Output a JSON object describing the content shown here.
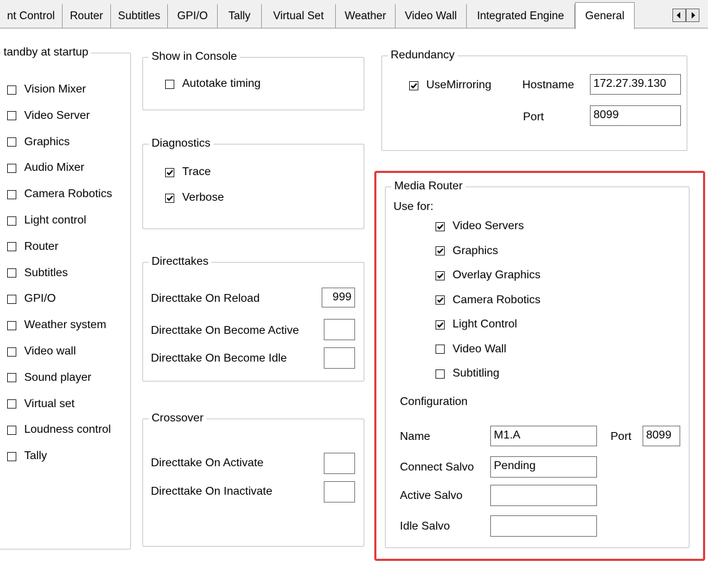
{
  "tabs": [
    {
      "label": "nt Control",
      "active": false
    },
    {
      "label": "Router",
      "active": false
    },
    {
      "label": "Subtitles",
      "active": false
    },
    {
      "label": "GPI/O",
      "active": false
    },
    {
      "label": "Tally",
      "active": false
    },
    {
      "label": "Virtual Set",
      "active": false
    },
    {
      "label": "Weather",
      "active": false
    },
    {
      "label": "Video Wall",
      "active": false
    },
    {
      "label": "Integrated Engine",
      "active": false
    },
    {
      "label": "General",
      "active": true
    }
  ],
  "scroll_buttons": {
    "left_icon": "arrow-left-icon",
    "right_icon": "arrow-right-icon"
  },
  "standby": {
    "title": "tandby at startup",
    "items": [
      {
        "label": "Vision Mixer",
        "checked": false
      },
      {
        "label": "Video Server",
        "checked": false
      },
      {
        "label": "Graphics",
        "checked": false
      },
      {
        "label": "Audio Mixer",
        "checked": false
      },
      {
        "label": "Camera Robotics",
        "checked": false
      },
      {
        "label": "Light control",
        "checked": false
      },
      {
        "label": "Router",
        "checked": false
      },
      {
        "label": "Subtitles",
        "checked": false
      },
      {
        "label": "GPI/O",
        "checked": false
      },
      {
        "label": "Weather system",
        "checked": false
      },
      {
        "label": "Video wall",
        "checked": false
      },
      {
        "label": "Sound player",
        "checked": false
      },
      {
        "label": "Virtual set",
        "checked": false
      },
      {
        "label": "Loudness control",
        "checked": false
      },
      {
        "label": "Tally",
        "checked": false
      }
    ]
  },
  "show_in_console": {
    "title": "Show in Console",
    "autotake": {
      "label": "Autotake timing",
      "checked": false
    }
  },
  "diagnostics": {
    "title": "Diagnostics",
    "trace": {
      "label": "Trace",
      "checked": true
    },
    "verbose": {
      "label": "Verbose",
      "checked": true
    }
  },
  "directtakes": {
    "title": "Directtakes",
    "on_reload": {
      "label": "Directtake On Reload",
      "value": "999"
    },
    "on_become_active": {
      "label": "Directtake On Become Active",
      "value": ""
    },
    "on_become_idle": {
      "label": "Directtake On Become Idle",
      "value": ""
    }
  },
  "crossover": {
    "title": "Crossover",
    "on_activate": {
      "label": "Directtake On Activate",
      "value": ""
    },
    "on_inactivate": {
      "label": "Directtake On Inactivate",
      "value": ""
    }
  },
  "redundancy": {
    "title": "Redundancy",
    "use_mirroring": {
      "label": "UseMirroring",
      "checked": true
    },
    "hostname": {
      "label": "Hostname",
      "value": "172.27.39.130"
    },
    "port": {
      "label": "Port",
      "value": "8099"
    }
  },
  "media_router": {
    "title": "Media Router",
    "use_for_label": "Use for:",
    "use_for": [
      {
        "label": "Video Servers",
        "checked": true
      },
      {
        "label": "Graphics",
        "checked": true
      },
      {
        "label": "Overlay Graphics",
        "checked": true
      },
      {
        "label": "Camera Robotics",
        "checked": true
      },
      {
        "label": "Light Control",
        "checked": true
      },
      {
        "label": "Video Wall",
        "checked": false
      },
      {
        "label": "Subtitling",
        "checked": false
      }
    ],
    "configuration_label": "Configuration",
    "name": {
      "label": "Name",
      "value": "M1.A"
    },
    "port": {
      "label": "Port",
      "value": "8099"
    },
    "connect_salvo": {
      "label": "Connect Salvo",
      "value": "Pending"
    },
    "active_salvo": {
      "label": "Active Salvo",
      "value": ""
    },
    "idle_salvo": {
      "label": "Idle Salvo",
      "value": ""
    }
  },
  "colors": {
    "highlight": "#e04040",
    "panel": "#ffffff",
    "chrome": "#f0f0f0"
  }
}
